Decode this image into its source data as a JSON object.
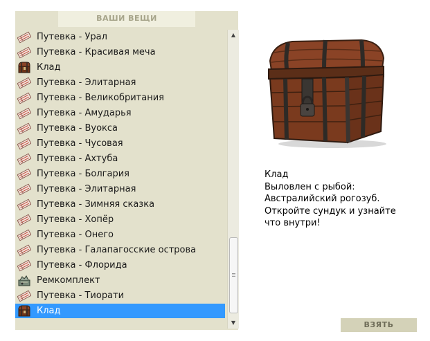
{
  "header": {
    "title": "ВАШИ ВЕЩИ"
  },
  "items": [
    {
      "label": "Путевка - Урал",
      "icon": "ticket-icon"
    },
    {
      "label": "Путевка - Красивая меча",
      "icon": "ticket-icon"
    },
    {
      "label": "Клад",
      "icon": "treasure-chest-icon"
    },
    {
      "label": "Путевка - Элитарная",
      "icon": "ticket-icon"
    },
    {
      "label": "Путевка - Великобритания",
      "icon": "ticket-icon"
    },
    {
      "label": "Путевка - Амударья",
      "icon": "ticket-icon"
    },
    {
      "label": "Путевка - Вуокса",
      "icon": "ticket-icon"
    },
    {
      "label": "Путевка - Чусовая",
      "icon": "ticket-icon"
    },
    {
      "label": "Путевка - Ахтуба",
      "icon": "ticket-icon"
    },
    {
      "label": "Путевка - Болгария",
      "icon": "ticket-icon"
    },
    {
      "label": "Путевка - Элитарная",
      "icon": "ticket-icon"
    },
    {
      "label": "Путевка - Зимняя сказка",
      "icon": "ticket-icon"
    },
    {
      "label": "Путевка - Хопёр",
      "icon": "ticket-icon"
    },
    {
      "label": "Путевка - Онего",
      "icon": "ticket-icon"
    },
    {
      "label": "Путевка - Галапагосские острова",
      "icon": "ticket-icon"
    },
    {
      "label": "Путевка - Флорида",
      "icon": "ticket-icon"
    },
    {
      "label": "Ремкомплект",
      "icon": "repair-kit-icon"
    },
    {
      "label": "Путевка - Тиорати",
      "icon": "ticket-icon"
    },
    {
      "label": "Клад",
      "icon": "treasure-chest-icon",
      "selected": true
    }
  ],
  "detail": {
    "image": "treasure-chest-image",
    "lines": [
      "Клад",
      "Выловлен с рыбой:",
      "Австралийский рогозуб.",
      "Откройте сундук и узнайте",
      "что внутри!"
    ]
  },
  "actions": {
    "take_label": "ВЗЯТЬ"
  },
  "colors": {
    "panel_bg": "#e3e1cc",
    "header_bg": "#f0efdf",
    "selection": "#3399ff",
    "button_bg": "#d4d2b8"
  }
}
